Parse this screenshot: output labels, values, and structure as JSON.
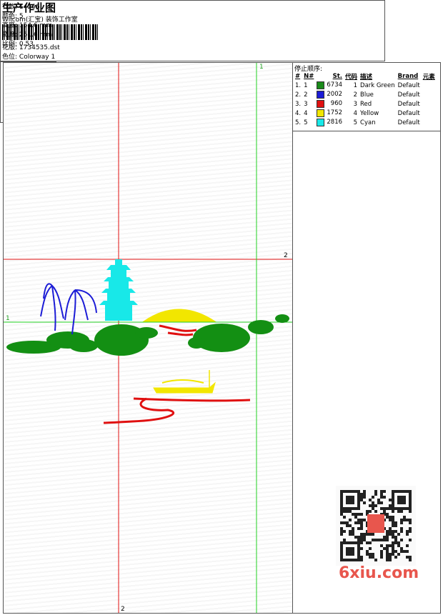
{
  "header": {
    "title": "生产作业图",
    "company": "Wilcom(汇宝) 装饰工作室",
    "design_label": "花版:",
    "design_value": "1734535.dst",
    "colorway_label": "色位:",
    "colorway_value": "Colorway 1"
  },
  "stats": [
    {
      "label": "针数:",
      "value": "14266"
    },
    {
      "label": "颜色:",
      "value": "5"
    },
    {
      "label": "高度:",
      "value": "154.6 mm"
    },
    {
      "label": "宽度:",
      "value": "251.6 mm"
    },
    {
      "label": "比例:",
      "value": "0.53"
    }
  ],
  "stop_sequence": {
    "label": "停止顺序:",
    "columns": [
      "#",
      "N#",
      "St.",
      "代码",
      "描述",
      "Brand",
      "元素"
    ],
    "rows": [
      {
        "idx": "1.",
        "n": "1",
        "color": "#1a8a1a",
        "st": "6734",
        "code": "1",
        "desc": "Dark Green",
        "brand": "Default"
      },
      {
        "idx": "2.",
        "n": "2",
        "color": "#1c1cd6",
        "st": "2002",
        "code": "2",
        "desc": "Blue",
        "brand": "Default"
      },
      {
        "idx": "3.",
        "n": "3",
        "color": "#e01010",
        "st": "960",
        "code": "3",
        "desc": "Red",
        "brand": "Default"
      },
      {
        "idx": "4.",
        "n": "4",
        "color": "#f2e600",
        "st": "1752",
        "code": "4",
        "desc": "Yellow",
        "brand": "Default"
      },
      {
        "idx": "5.",
        "n": "5",
        "color": "#18e8e8",
        "st": "2816",
        "code": "5",
        "desc": "Cyan",
        "brand": "Default"
      }
    ]
  },
  "guides": {
    "red_v_top": "",
    "red_v_bottom": "2",
    "red_h_right": "2",
    "green_v_top": "1",
    "green_h_left": "1"
  },
  "watermark": {
    "text": "6xiu.com",
    "color": "#e8564d"
  }
}
